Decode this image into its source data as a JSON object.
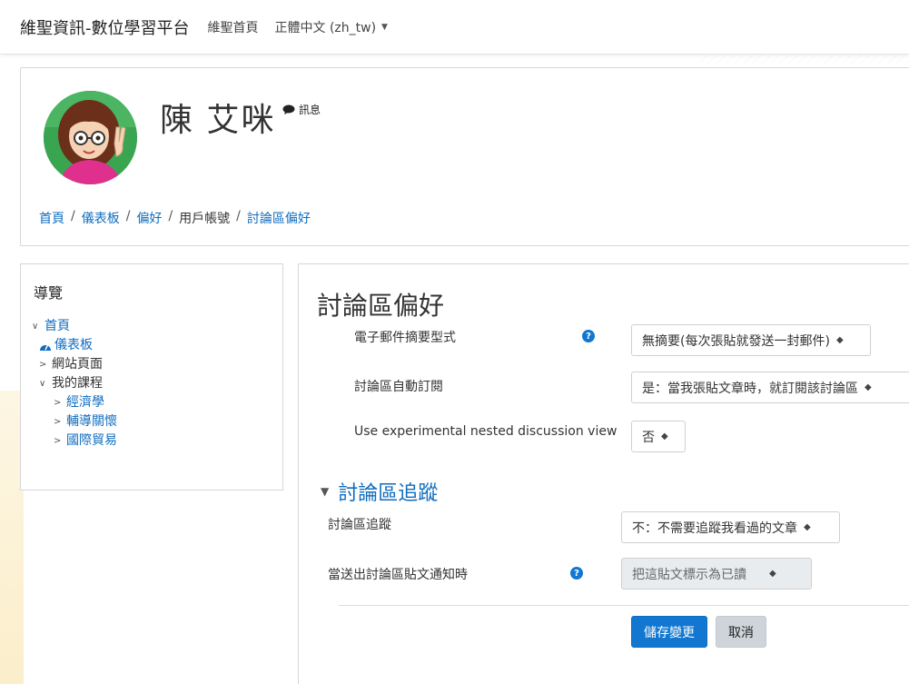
{
  "navbar": {
    "brand": "維聖資訊-數位學習平台",
    "home_link": "維聖首頁",
    "language": "正體中文 (zh_tw)"
  },
  "header": {
    "user_name": "陳 艾咪",
    "message_label": "訊息",
    "breadcrumb": [
      "首頁",
      "儀表板",
      "偏好",
      "用戶帳號",
      "討論區偏好"
    ]
  },
  "sidebar": {
    "title": "導覽",
    "items": [
      {
        "label": "首頁"
      },
      {
        "label": "儀表板"
      },
      {
        "label": "網站頁面"
      },
      {
        "label": "我的課程"
      },
      {
        "label": "經濟學"
      },
      {
        "label": "輔導關懷"
      },
      {
        "label": "國際貿易"
      }
    ]
  },
  "main": {
    "title": "討論區偏好",
    "fields": [
      {
        "label": "電子郵件摘要型式",
        "value": "無摘要(每次張貼就發送一封郵件)"
      },
      {
        "label": "討論區自動訂閱",
        "value": "是：當我張貼文章時，就訂閱該討論區"
      },
      {
        "label": "Use experimental nested discussion view",
        "value": "否"
      }
    ],
    "tracking_section": {
      "title": "討論區追蹤",
      "fields": [
        {
          "label": "討論區追蹤",
          "value": "不：不需要追蹤我看過的文章"
        },
        {
          "label": "當送出討論區貼文通知時",
          "value": "把這貼文標示為已讀"
        }
      ]
    },
    "save_label": "儲存變更",
    "cancel_label": "取消"
  },
  "colors": {
    "link": "#0f6cbf",
    "primary_button": "#1177d1",
    "secondary_button": "#ced4da"
  },
  "icons": {
    "message": "speech-bubble-icon",
    "help": "question-circle-icon",
    "dashboard": "tachometer-icon"
  }
}
